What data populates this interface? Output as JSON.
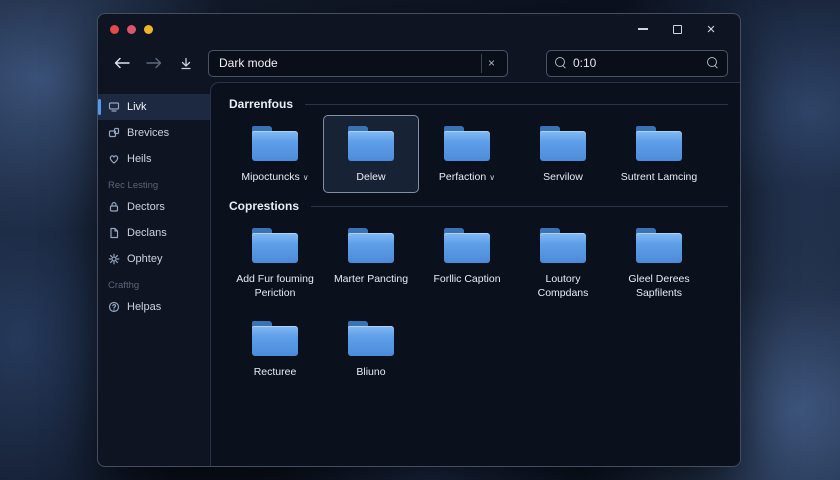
{
  "titlebar": {
    "traffic_lights": [
      "#e5484d",
      "#d9566b",
      "#f0b429"
    ],
    "close_label": "×"
  },
  "toolbar": {
    "address": {
      "value": "Dark mode",
      "clear_label": "×"
    },
    "search": {
      "value": "0:10"
    }
  },
  "sidebar": {
    "accent": "#4f9cf0",
    "items": [
      {
        "label": "Livk"
      },
      {
        "label": "Brevices"
      },
      {
        "label": "Heils"
      },
      {
        "label": "Rec Lesting"
      },
      {
        "label": "Dectors"
      },
      {
        "label": "Declans"
      },
      {
        "label": "Ophtey"
      },
      {
        "label": "Crafthg"
      },
      {
        "label": "Helpas"
      }
    ]
  },
  "content": {
    "sections": [
      {
        "title": "Darrenfous",
        "items": [
          {
            "label": "Mipoctuncks",
            "chevron": "∨"
          },
          {
            "label": "Delew"
          },
          {
            "label": "Perfaction",
            "chevron": "∨"
          },
          {
            "label": "Servilow"
          },
          {
            "label": "Sutrent Lamcing"
          }
        ]
      },
      {
        "title": "Coprestions",
        "items": [
          {
            "label": "Add Fur fouming Periction"
          },
          {
            "label": "Marter Pancting"
          },
          {
            "label": "Forllic Caption"
          },
          {
            "label": "Loutory Compdans"
          },
          {
            "label": "Gleel Derees Sapfilents"
          },
          {
            "label": "Recturee"
          },
          {
            "label": "Bliuno"
          }
        ]
      }
    ]
  }
}
